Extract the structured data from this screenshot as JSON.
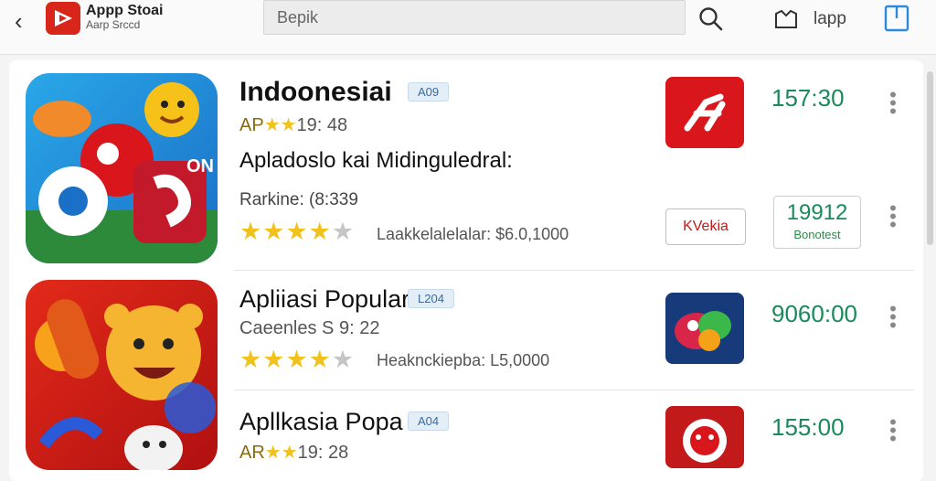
{
  "header": {
    "back_glyph": "‹",
    "brand_name": "Appp Stoai",
    "brand_subtitle": "Aarp Srccd",
    "search_placeholder": "Bepik",
    "right_label": "lapp",
    "icons": [
      "chevron-left-icon",
      "play-logo-icon",
      "search-icon",
      "bag-icon",
      "share-icon"
    ]
  },
  "items": [
    {
      "title": "Indoonesiai",
      "tag": "A09",
      "meta_prefix": "AP",
      "meta_stars": "★★",
      "meta_text": "19: 48",
      "description": "Apladoslo kai Midinguledral:",
      "ranking": "Rarkine: (8:339",
      "rating": 4,
      "price_note": "Laakkelalelalar: $6.0,1000",
      "side_value": "157:30",
      "mini_badge_text": "KVekia",
      "count_big": "19912",
      "count_small": "Bonotest",
      "mini_icon": "red-f-app-icon"
    },
    {
      "title": "Apliiasi Popular",
      "tag": "L204",
      "meta_text": "Caeenles S 9: 22",
      "rating": 4,
      "price_note": "Heaknckiepba: L5,0000",
      "side_value": "9060:00",
      "mini_icon": "colorful-game-icon"
    },
    {
      "title": "Apllkasia Popa",
      "tag": "A04",
      "meta_prefix": "AR",
      "meta_stars": "★★",
      "meta_text": "19: 28",
      "side_value": "155:00",
      "mini_icon": "red-mascot-icon"
    }
  ],
  "colors": {
    "accent_red": "#d8261b",
    "green_value": "#1a8a5a",
    "star": "#f1c21b"
  }
}
